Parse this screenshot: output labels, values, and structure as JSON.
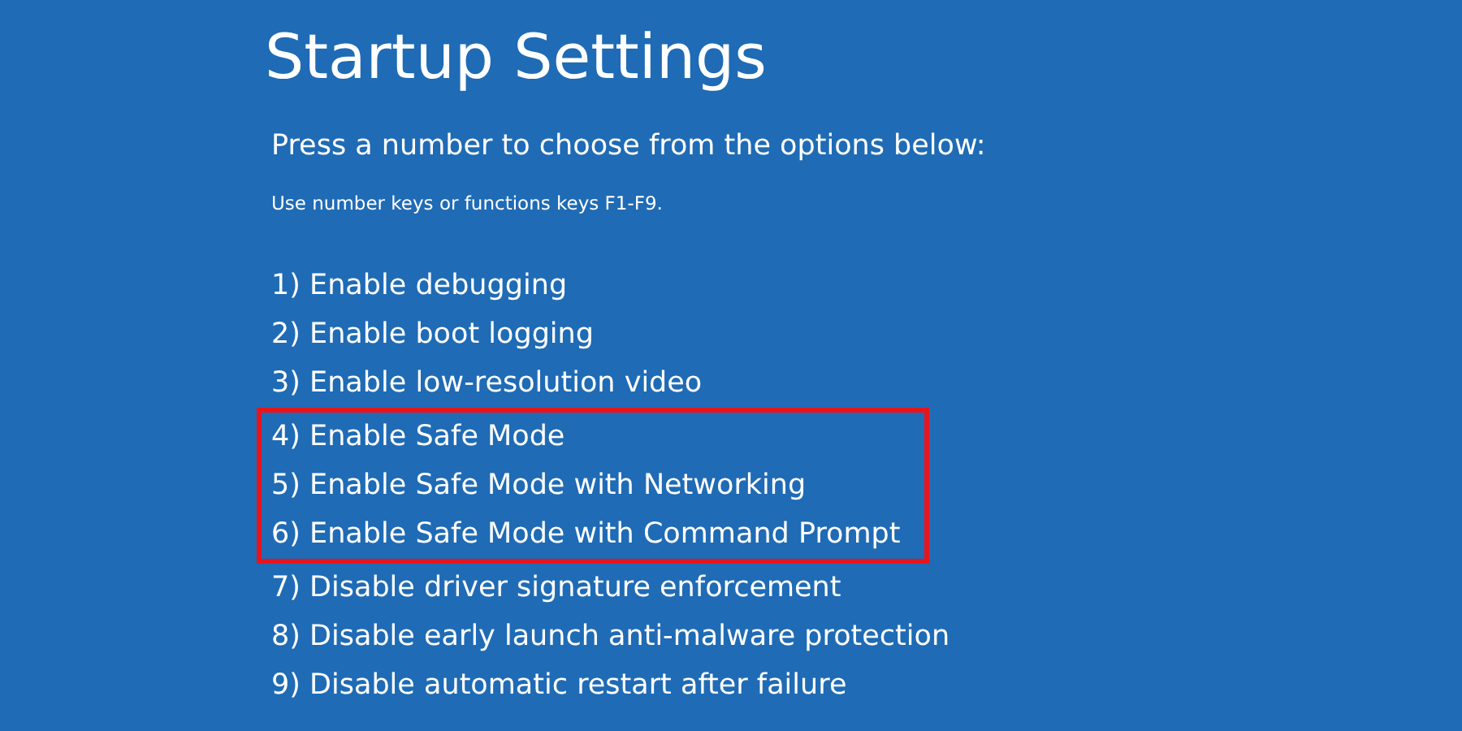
{
  "title": "Startup Settings",
  "prompt": "Press a number to choose from the options below:",
  "hint": "Use number keys or functions keys F1-F9.",
  "options": [
    {
      "label": "1) Enable debugging",
      "highlighted": false
    },
    {
      "label": "2) Enable boot logging",
      "highlighted": false
    },
    {
      "label": "3) Enable low-resolution video",
      "highlighted": false
    },
    {
      "label": "4) Enable Safe Mode",
      "highlighted": true
    },
    {
      "label": "5) Enable Safe Mode with Networking",
      "highlighted": true
    },
    {
      "label": "6) Enable Safe Mode with Command Prompt",
      "highlighted": true
    },
    {
      "label": "7) Disable driver signature enforcement",
      "highlighted": false
    },
    {
      "label": "8) Disable early launch anti-malware protection",
      "highlighted": false
    },
    {
      "label": "9) Disable automatic restart after failure",
      "highlighted": false
    }
  ]
}
